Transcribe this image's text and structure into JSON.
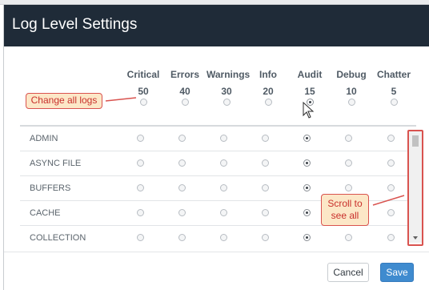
{
  "modal": {
    "title": "Log Level Settings"
  },
  "levels": [
    {
      "name": "Critical",
      "value": "50"
    },
    {
      "name": "Errors",
      "value": "40"
    },
    {
      "name": "Warnings",
      "value": "30"
    },
    {
      "name": "Info",
      "value": "20"
    },
    {
      "name": "Audit",
      "value": "15"
    },
    {
      "name": "Debug",
      "value": "10"
    },
    {
      "name": "Chatter",
      "value": "5"
    }
  ],
  "all_logs_selected": "Audit",
  "rows": [
    {
      "label": "ADMIN",
      "selected": "Audit"
    },
    {
      "label": "ASYNC FILE",
      "selected": "Audit"
    },
    {
      "label": "BUFFERS",
      "selected": "Audit"
    },
    {
      "label": "CACHE",
      "selected": "Audit"
    },
    {
      "label": "COLLECTION",
      "selected": "Audit"
    }
  ],
  "callouts": {
    "change_all": "Change all logs",
    "scroll_line1": "Scroll to",
    "scroll_line2": "see all"
  },
  "buttons": {
    "cancel": "Cancel",
    "save": "Save"
  },
  "colors": {
    "header": "#1f2b38",
    "accent": "#3f8bcf",
    "callout_border": "#d9534f",
    "callout_fill": "#fce7c7"
  },
  "icons": {
    "cursor": "mouse-pointer-icon",
    "scroll_down": "chevron-down-icon"
  }
}
